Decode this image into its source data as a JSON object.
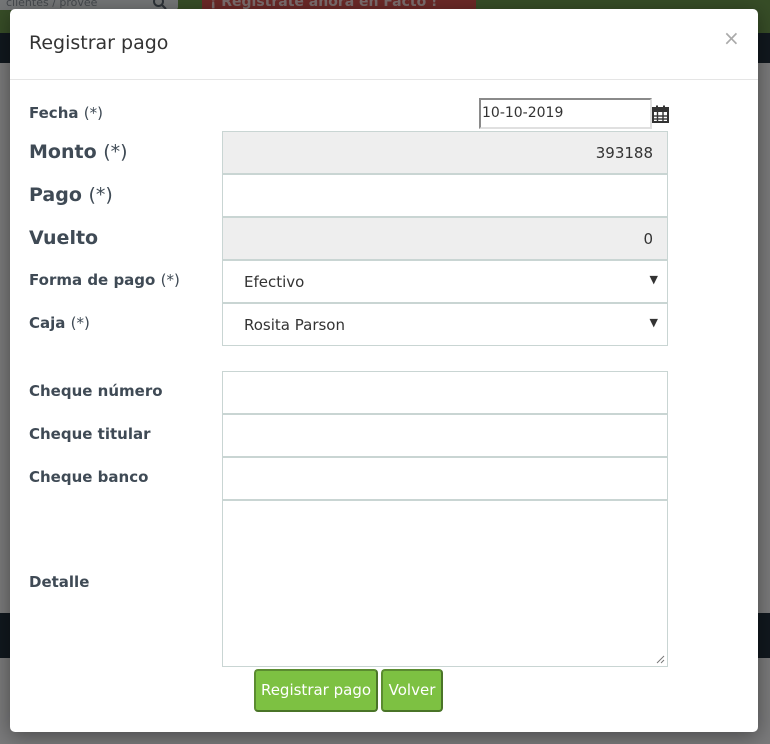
{
  "background": {
    "search_placeholder": "clientes / provee",
    "promo_text": "¡ Regístrate ahora en Facto !"
  },
  "modal": {
    "title": "Registrar pago",
    "close_label": "×"
  },
  "form": {
    "fecha": {
      "label": "Fecha",
      "required": "(*)",
      "value": "10-10-2019"
    },
    "monto": {
      "label": "Monto",
      "required": "(*)",
      "value": "393188"
    },
    "pago": {
      "label": "Pago",
      "required": "(*)",
      "value": ""
    },
    "vuelto": {
      "label": "Vuelto",
      "value": "0"
    },
    "forma_pago": {
      "label": "Forma de pago",
      "required": "(*)",
      "selected": "Efectivo"
    },
    "caja": {
      "label": "Caja",
      "required": "(*)",
      "selected": "Rosita Parson"
    },
    "cheque_numero": {
      "label": "Cheque número",
      "value": ""
    },
    "cheque_titular": {
      "label": "Cheque titular",
      "value": ""
    },
    "cheque_banco": {
      "label": "Cheque banco",
      "value": ""
    },
    "detalle": {
      "label": "Detalle",
      "value": ""
    }
  },
  "buttons": {
    "save_label": "Registrar pago",
    "back_label": "Volver"
  },
  "icons": {
    "calendar": "calendar-icon",
    "dropdown": "caret-down-icon",
    "close": "close-icon",
    "search": "search-icon"
  },
  "colors": {
    "button_green": "#7dc142",
    "readonly_bg": "#eeeeee",
    "label_text": "#3f4a55"
  }
}
